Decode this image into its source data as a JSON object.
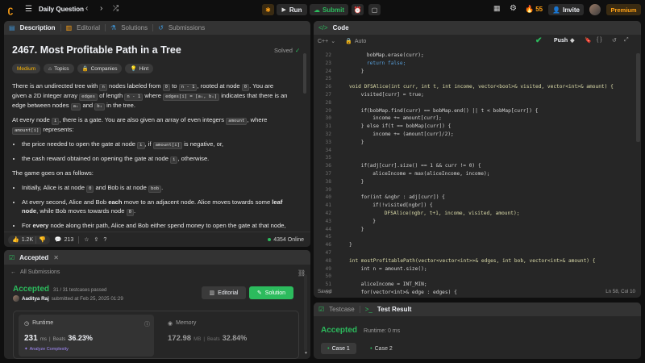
{
  "topbar": {
    "title": "Daily Question",
    "run": "Run",
    "submit": "Submit",
    "streak": "55",
    "invite": "Invite",
    "premium": "Premium"
  },
  "tabs": {
    "description": "Description",
    "editorial": "Editorial",
    "solutions": "Solutions",
    "submissions": "Submissions"
  },
  "problem": {
    "title": "2467. Most Profitable Path in a Tree",
    "status": "Solved",
    "difficulty": "Medium",
    "topics": "Topics",
    "companies": "Companies",
    "hint": "Hint",
    "p1a": "There is an undirected tree with ",
    "p1b": " nodes labeled from ",
    "p1c": " to ",
    "p1d": ", rooted at node ",
    "p1e": ". You are given a 2D integer array ",
    "p1f": " of length ",
    "p1g": " where ",
    "p1h": " indicates that there is an edge between nodes ",
    "p1i": " and ",
    "p1j": " in the tree.",
    "p2a": "At every node ",
    "p2b": ", there is a gate. You are also given an array of even integers ",
    "p2c": ", where ",
    "p2d": " represents:",
    "b1a": "the price needed to open the gate at node ",
    "b1b": ", if ",
    "b1c": " is negative, or,",
    "b2a": "the cash reward obtained on opening the gate at node ",
    "b2b": ", otherwise.",
    "p3": "The game goes on as follows:",
    "c1a": "Initially, Alice is at node ",
    "c1b": " and Bob is at node ",
    "c1c": ".",
    "c2a": "At every second, Alice and Bob ",
    "c2b": "each",
    "c2c": " move to an adjacent node. Alice moves towards some ",
    "c2d": "leaf node",
    "c2e": ", while Bob moves towards node ",
    "c2f": ".",
    "c3a": "For ",
    "c3b": "every",
    "c3c": " node along their path, Alice and Bob either spend money to open the gate at that node, or",
    "n": "n",
    "zero": "0",
    "nm1": "n - 1",
    "edges": "edges",
    "edgeseq": "edges[i] = [aᵢ, bᵢ]",
    "ai": "aᵢ",
    "bi": "bᵢ",
    "i": "i",
    "amount": "amount",
    "amounti": "amount[i]",
    "bob": "bob",
    "likes": "1.2K",
    "comments": "213",
    "online": "4354 Online"
  },
  "submission": {
    "tab": "Accepted",
    "back": "All Submissions",
    "verdict": "Accepted",
    "passed": "31 / 31 testcases passed",
    "user": "Aaditya Raj",
    "submitted": "submitted at Feb 25, 2025 01:29",
    "editorial": "Editorial",
    "solution": "Solution",
    "runtime_label": "Runtime",
    "runtime_val": "231",
    "runtime_unit": "ms",
    "beats": "Beats",
    "runtime_beats": "36.23%",
    "analyze": "Analyze Complexity",
    "memory_label": "Memory",
    "memory_val": "172.98",
    "memory_unit": "MB",
    "memory_beats": "32.84%"
  },
  "editor": {
    "tab": "Code",
    "lang": "C++",
    "mode": "Auto",
    "push": "Push",
    "status": "Saved",
    "cursor": "Ln 58, Col 10",
    "lines": [
      {
        "n": "22",
        "t": "bobMap.erase(curr);",
        "c": "pl",
        "i": 3
      },
      {
        "n": "23",
        "t": "return false;",
        "c": "kw",
        "i": 3
      },
      {
        "n": "24",
        "t": "}",
        "c": "pl",
        "i": 2
      },
      {
        "n": "25",
        "t": "",
        "c": "pl",
        "i": 0
      },
      {
        "n": "26",
        "t": "void DFSAlice(int curr, int t, int income, vector<bool>& visited, vector<int>& amount) {",
        "c": "fn",
        "i": 0
      },
      {
        "n": "27",
        "t": "visited[curr] = true;",
        "c": "pl",
        "i": 2
      },
      {
        "n": "28",
        "t": "",
        "c": "pl",
        "i": 0
      },
      {
        "n": "29",
        "t": "if(bobMap.find(curr) == bobMap.end() || t < bobMap[curr]) {",
        "c": "pl",
        "i": 2
      },
      {
        "n": "30",
        "t": "income += amount[curr];",
        "c": "pl",
        "i": 4
      },
      {
        "n": "31",
        "t": "} else if(t == bobMap[curr]) {",
        "c": "pl",
        "i": 2
      },
      {
        "n": "32",
        "t": "income += (amount[curr]/2);",
        "c": "pl",
        "i": 4
      },
      {
        "n": "33",
        "t": "}",
        "c": "pl",
        "i": 2
      },
      {
        "n": "34",
        "t": "",
        "c": "pl",
        "i": 0
      },
      {
        "n": "35",
        "t": "",
        "c": "pl",
        "i": 0
      },
      {
        "n": "36",
        "t": "if(adj[curr].size() == 1 && curr != 0) {",
        "c": "pl",
        "i": 2
      },
      {
        "n": "37",
        "t": "aliceIncome = max(aliceIncome, income);",
        "c": "pl",
        "i": 4
      },
      {
        "n": "38",
        "t": "}",
        "c": "pl",
        "i": 2
      },
      {
        "n": "39",
        "t": "",
        "c": "pl",
        "i": 0
      },
      {
        "n": "40",
        "t": "for(int &ngbr : adj[curr]) {",
        "c": "pl",
        "i": 2
      },
      {
        "n": "41",
        "t": "if(!visited[ngbr]) {",
        "c": "pl",
        "i": 4
      },
      {
        "n": "42",
        "t": "DFSAlice(ngbr, t+1, income, visited, amount);",
        "c": "fn",
        "i": 6
      },
      {
        "n": "43",
        "t": "}",
        "c": "pl",
        "i": 4
      },
      {
        "n": "44",
        "t": "}",
        "c": "pl",
        "i": 2
      },
      {
        "n": "45",
        "t": "",
        "c": "pl",
        "i": 0
      },
      {
        "n": "46",
        "t": "}",
        "c": "pl",
        "i": 0
      },
      {
        "n": "47",
        "t": "",
        "c": "pl",
        "i": 0
      },
      {
        "n": "48",
        "t": "int mostProfitablePath(vector<vector<int>>& edges, int bob, vector<int>& amount) {",
        "c": "fn",
        "i": 0
      },
      {
        "n": "49",
        "t": "int n = amount.size();",
        "c": "pl",
        "i": 2
      },
      {
        "n": "50",
        "t": "",
        "c": "pl",
        "i": 0
      },
      {
        "n": "51",
        "t": "aliceIncome = INT_MIN;",
        "c": "pl",
        "i": 2
      },
      {
        "n": "52",
        "t": "for(vector<int>& edge : edges) {",
        "c": "pl",
        "i": 2
      }
    ]
  },
  "testpanel": {
    "testcase": "Testcase",
    "result": "Test Result",
    "verdict": "Accepted",
    "runtime": "Runtime: 0 ms",
    "case1": "Case 1",
    "case2": "Case 2"
  },
  "colors": {
    "accent": "#ffa116",
    "green": "#2cbb5d",
    "medium": "#ffb800",
    "bg": "#0f0f0f",
    "panel": "#262626"
  }
}
